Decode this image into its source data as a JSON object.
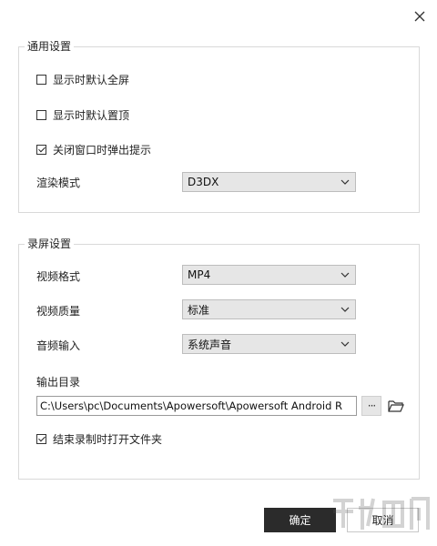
{
  "dialog": {
    "close_icon": "close-icon"
  },
  "general": {
    "title": "通用设置",
    "fullscreen_label": "显示时默认全屏",
    "fullscreen_checked": false,
    "topmost_label": "显示时默认置顶",
    "topmost_checked": false,
    "close_prompt_label": "关闭窗口时弹出提示",
    "close_prompt_checked": true,
    "render_mode_label": "渲染模式",
    "render_mode_value": "D3DX"
  },
  "recording": {
    "title": "录屏设置",
    "video_format_label": "视频格式",
    "video_format_value": "MP4",
    "video_quality_label": "视频质量",
    "video_quality_value": "标准",
    "audio_input_label": "音频输入",
    "audio_input_value": "系统声音",
    "output_dir_label": "输出目录",
    "output_dir_value": "C:\\Users\\pc\\Documents\\Apowersoft\\Apowersoft Android R",
    "browse_label": "···",
    "open_folder_label": "结束录制时打开文件夹",
    "open_folder_checked": true
  },
  "buttons": {
    "ok_label": "确定",
    "cancel_label": "取消"
  },
  "colors": {
    "ok_bg": "#2b2b2b",
    "select_bg": "#e6e6e6"
  }
}
